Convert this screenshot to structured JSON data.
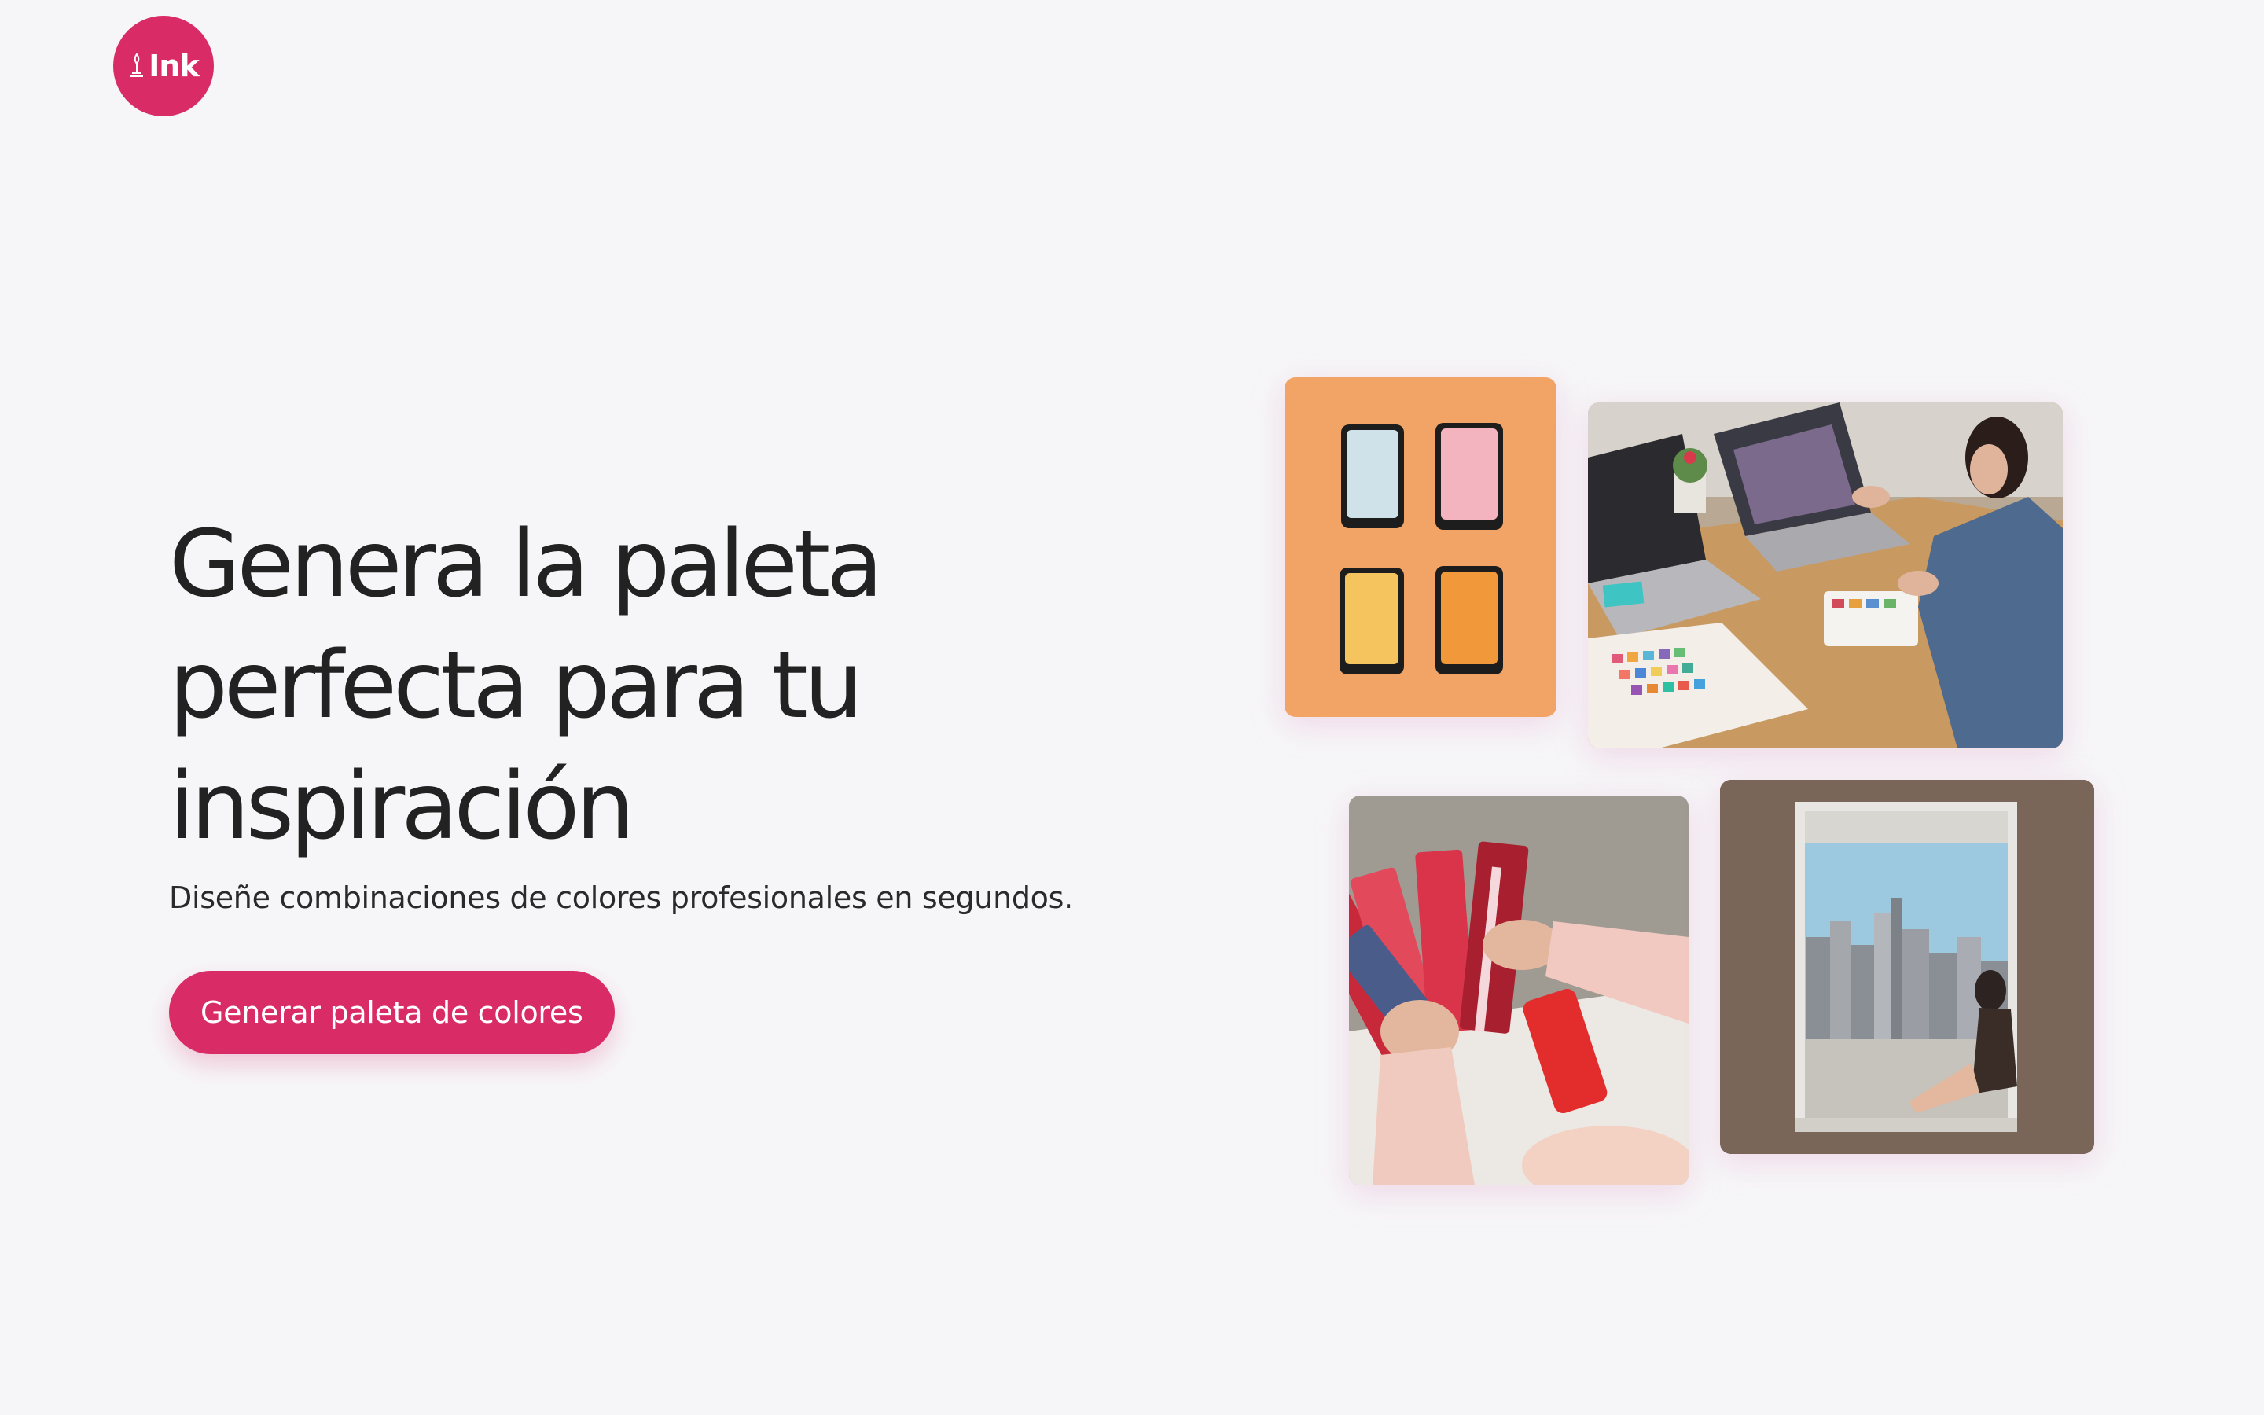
{
  "brand": {
    "logo_text": "Ink",
    "accent_color": "#d92b66",
    "background_color": "#f6f6f8"
  },
  "hero": {
    "title_lines": [
      "Genera la paleta",
      "perfecta para tu",
      "inspiración"
    ],
    "subtitle": "Diseñe combinaciones de colores profesionales en segundos.",
    "cta_label": "Generar paleta de colores"
  },
  "collage": {
    "phone_colors": [
      "#cfe2ea",
      "#f3b3bf",
      "#f6c45e",
      "#f0983a"
    ],
    "card_background": "#f2a466"
  }
}
